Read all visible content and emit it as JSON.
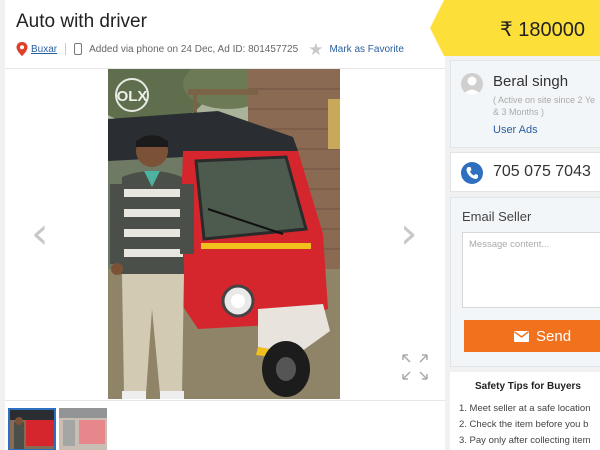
{
  "listing": {
    "title": "Auto with driver",
    "location": "Buxar",
    "added_info": "Added via phone on 24 Dec, Ad ID: 801457725",
    "favorite_label": "Mark as Favorite"
  },
  "gallery": {
    "watermark": "OLX",
    "thumbnail_count": 2,
    "selected_thumbnail": 1
  },
  "price": {
    "text": "₹ 180000"
  },
  "seller": {
    "name": "Beral singh",
    "active_note_line1": "( Active on site since 2 Ye",
    "active_note_line2": "& 3 Months )",
    "user_ads_label": "User Ads"
  },
  "contact": {
    "phone": "705 075 7043"
  },
  "email_seller": {
    "label": "Email Seller",
    "message_placeholder": "Message content...",
    "send_label": "Send"
  },
  "safety": {
    "heading": "Safety Tips for Buyers",
    "tips": [
      "1.  Meet seller at a safe location",
      "2.  Check the item before you b",
      "3.  Pay only after collecting item"
    ]
  },
  "colors": {
    "price_bg": "#fddf3a",
    "send_bg": "#f2711c",
    "link": "#2a5fa0",
    "accent_blue": "#2f6fbf"
  }
}
